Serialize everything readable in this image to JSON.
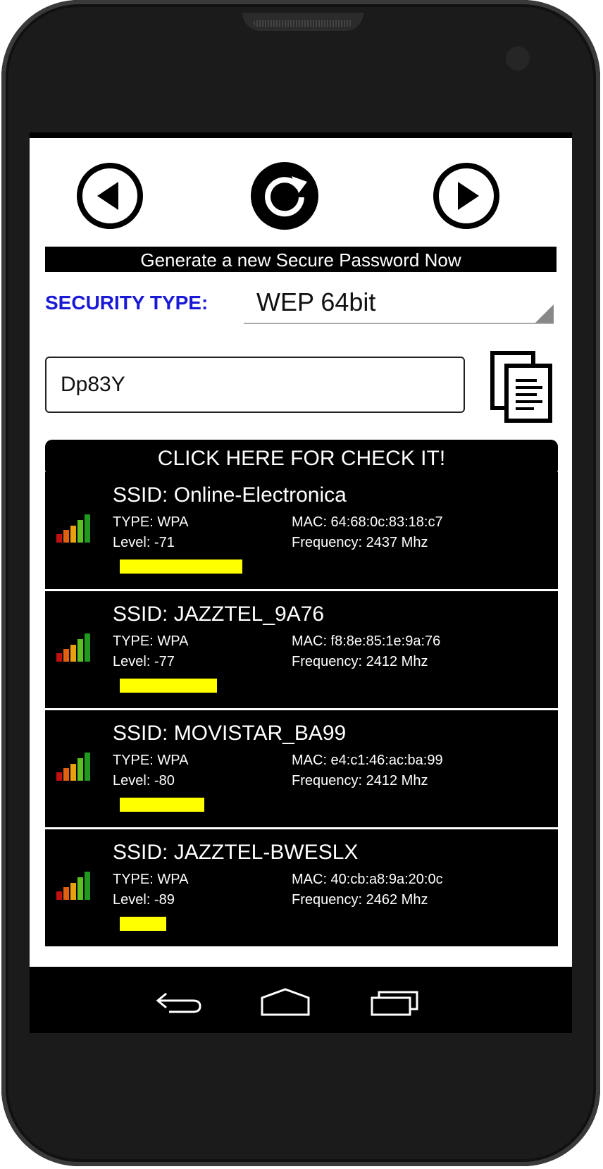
{
  "nav": {
    "prev_icon": "arrow-left-circle-icon",
    "refresh_icon": "refresh-circle-icon",
    "next_icon": "arrow-right-circle-icon"
  },
  "generate_banner": "Generate a new Secure Password Now",
  "security": {
    "label": "SECURITY TYPE:",
    "selected": "WEP 64bit"
  },
  "password": {
    "value": "Dp83Y"
  },
  "copy_icon": "copy-icon",
  "check_button": "CLICK HERE FOR CHECK IT!",
  "networks": [
    {
      "ssid": "SSID: Online-Electronica",
      "type": "TYPE: WPA",
      "level": "Level: -71",
      "mac": "MAC: 64:68:0c:83:18:c7",
      "frequency": "Frequency: 2437 Mhz",
      "strength": 0.29
    },
    {
      "ssid": "SSID: JAZZTEL_9A76",
      "type": "TYPE: WPA",
      "level": "Level: -77",
      "mac": "MAC: f8:8e:85:1e:9a:76",
      "frequency": "Frequency: 2412 Mhz",
      "strength": 0.23
    },
    {
      "ssid": "SSID: MOVISTAR_BA99",
      "type": "TYPE: WPA",
      "level": "Level: -80",
      "mac": "MAC: e4:c1:46:ac:ba:99",
      "frequency": "Frequency: 2412 Mhz",
      "strength": 0.2
    },
    {
      "ssid": "SSID: JAZZTEL-BWESLX",
      "type": "TYPE: WPA",
      "level": "Level: -89",
      "mac": "MAC: 40:cb:a8:9a:20:0c",
      "frequency": "Frequency: 2462 Mhz",
      "strength": 0.11
    }
  ],
  "colors": {
    "label_blue": "#1a1ad6",
    "strength_bar": "#ffff00",
    "card_bg": "#000000"
  },
  "system_nav": [
    "back-icon",
    "home-icon",
    "recent-apps-icon"
  ]
}
